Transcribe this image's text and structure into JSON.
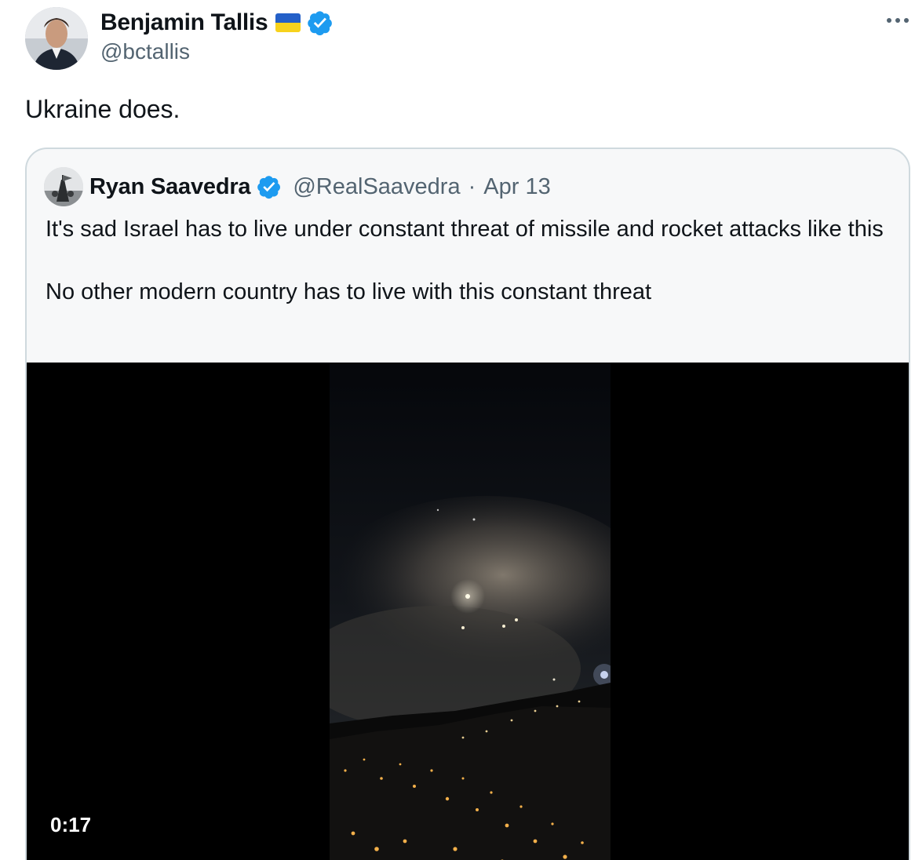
{
  "author": {
    "name": "Benjamin Tallis",
    "handle": "@bctallis",
    "flag_colors": [
      "#2460c8",
      "#f7d21d"
    ],
    "verified_color": "#1d9bf0"
  },
  "tweet": {
    "text": "Ukraine does."
  },
  "quote": {
    "name": "Ryan Saavedra",
    "handle": "@RealSaavedra",
    "separator": "·",
    "date": "Apr 13",
    "body": "It's sad Israel has to live under constant threat of missile and rocket attacks like this\n\nNo other modern country has to live with this constant threat",
    "video_duration": "0:17"
  },
  "icons": {
    "more": "more-horizontal-icon",
    "verified": "verified-badge-icon"
  }
}
